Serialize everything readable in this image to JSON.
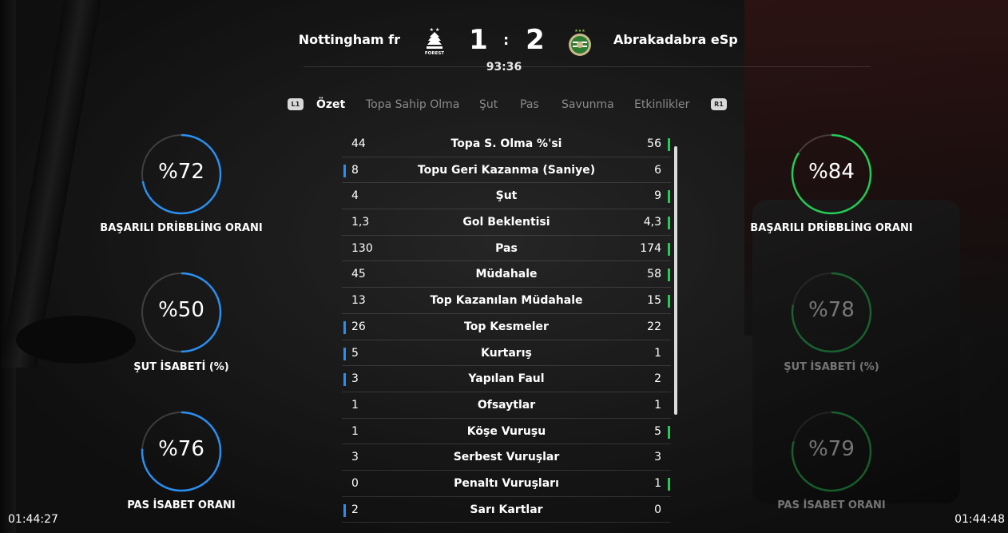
{
  "match": {
    "home_team": "Nottingham fr",
    "away_team": "Abrakadabra eSp",
    "home_score": "1",
    "away_score": "2",
    "separator": ":",
    "clock": "93:36",
    "home_crest_text": "FOREST"
  },
  "tabs": {
    "left_hint": "L1",
    "right_hint": "R1",
    "items": [
      "Özet",
      "Topa Sahip Olma",
      "Şut",
      "Pas",
      "Savunma",
      "Etkinlikler"
    ],
    "active": "Özet"
  },
  "left_rings": [
    {
      "value": "%72",
      "label": "BAŞARILI DRİBBLİNG ORANI",
      "percent": 72
    },
    {
      "value": "%50",
      "label": "ŞUT İSABETİ (%)",
      "percent": 50
    },
    {
      "value": "%76",
      "label": "PAS İSABET ORANI",
      "percent": 76
    }
  ],
  "right_rings": [
    {
      "value": "%84",
      "label": "BAŞARILI DRİBBLİNG ORANI",
      "percent": 84
    },
    {
      "value": "%78",
      "label": "ŞUT İSABETİ (%)",
      "percent": 78
    },
    {
      "value": "%79",
      "label": "PAS İSABET ORANI",
      "percent": 79
    }
  ],
  "stats": [
    {
      "home": "44",
      "name": "Topa S. Olma %'si",
      "away": "56",
      "lead": "away"
    },
    {
      "home": "8",
      "name": "Topu Geri Kazanma (Saniye)",
      "away": "6",
      "lead": "home"
    },
    {
      "home": "4",
      "name": "Şut",
      "away": "9",
      "lead": "away"
    },
    {
      "home": "1,3",
      "name": "Gol Beklentisi",
      "away": "4,3",
      "lead": "away"
    },
    {
      "home": "130",
      "name": "Pas",
      "away": "174",
      "lead": "away"
    },
    {
      "home": "45",
      "name": "Müdahale",
      "away": "58",
      "lead": "away"
    },
    {
      "home": "13",
      "name": "Top Kazanılan Müdahale",
      "away": "15",
      "lead": "away"
    },
    {
      "home": "26",
      "name": "Top Kesmeler",
      "away": "22",
      "lead": "home"
    },
    {
      "home": "5",
      "name": "Kurtarış",
      "away": "1",
      "lead": "home"
    },
    {
      "home": "3",
      "name": "Yapılan Faul",
      "away": "2",
      "lead": "home"
    },
    {
      "home": "1",
      "name": "Ofsaytlar",
      "away": "1",
      "lead": "none"
    },
    {
      "home": "1",
      "name": "Köşe Vuruşu",
      "away": "5",
      "lead": "away"
    },
    {
      "home": "3",
      "name": "Serbest Vuruşlar",
      "away": "3",
      "lead": "none"
    },
    {
      "home": "0",
      "name": "Penaltı Vuruşları",
      "away": "1",
      "lead": "away"
    },
    {
      "home": "2",
      "name": "Sarı Kartlar",
      "away": "0",
      "lead": "home"
    }
  ],
  "timestamps": {
    "left": "01:44:27",
    "right": "01:44:48"
  },
  "colors": {
    "home_accent": "#2a8ff0",
    "away_accent": "#22cc55"
  }
}
